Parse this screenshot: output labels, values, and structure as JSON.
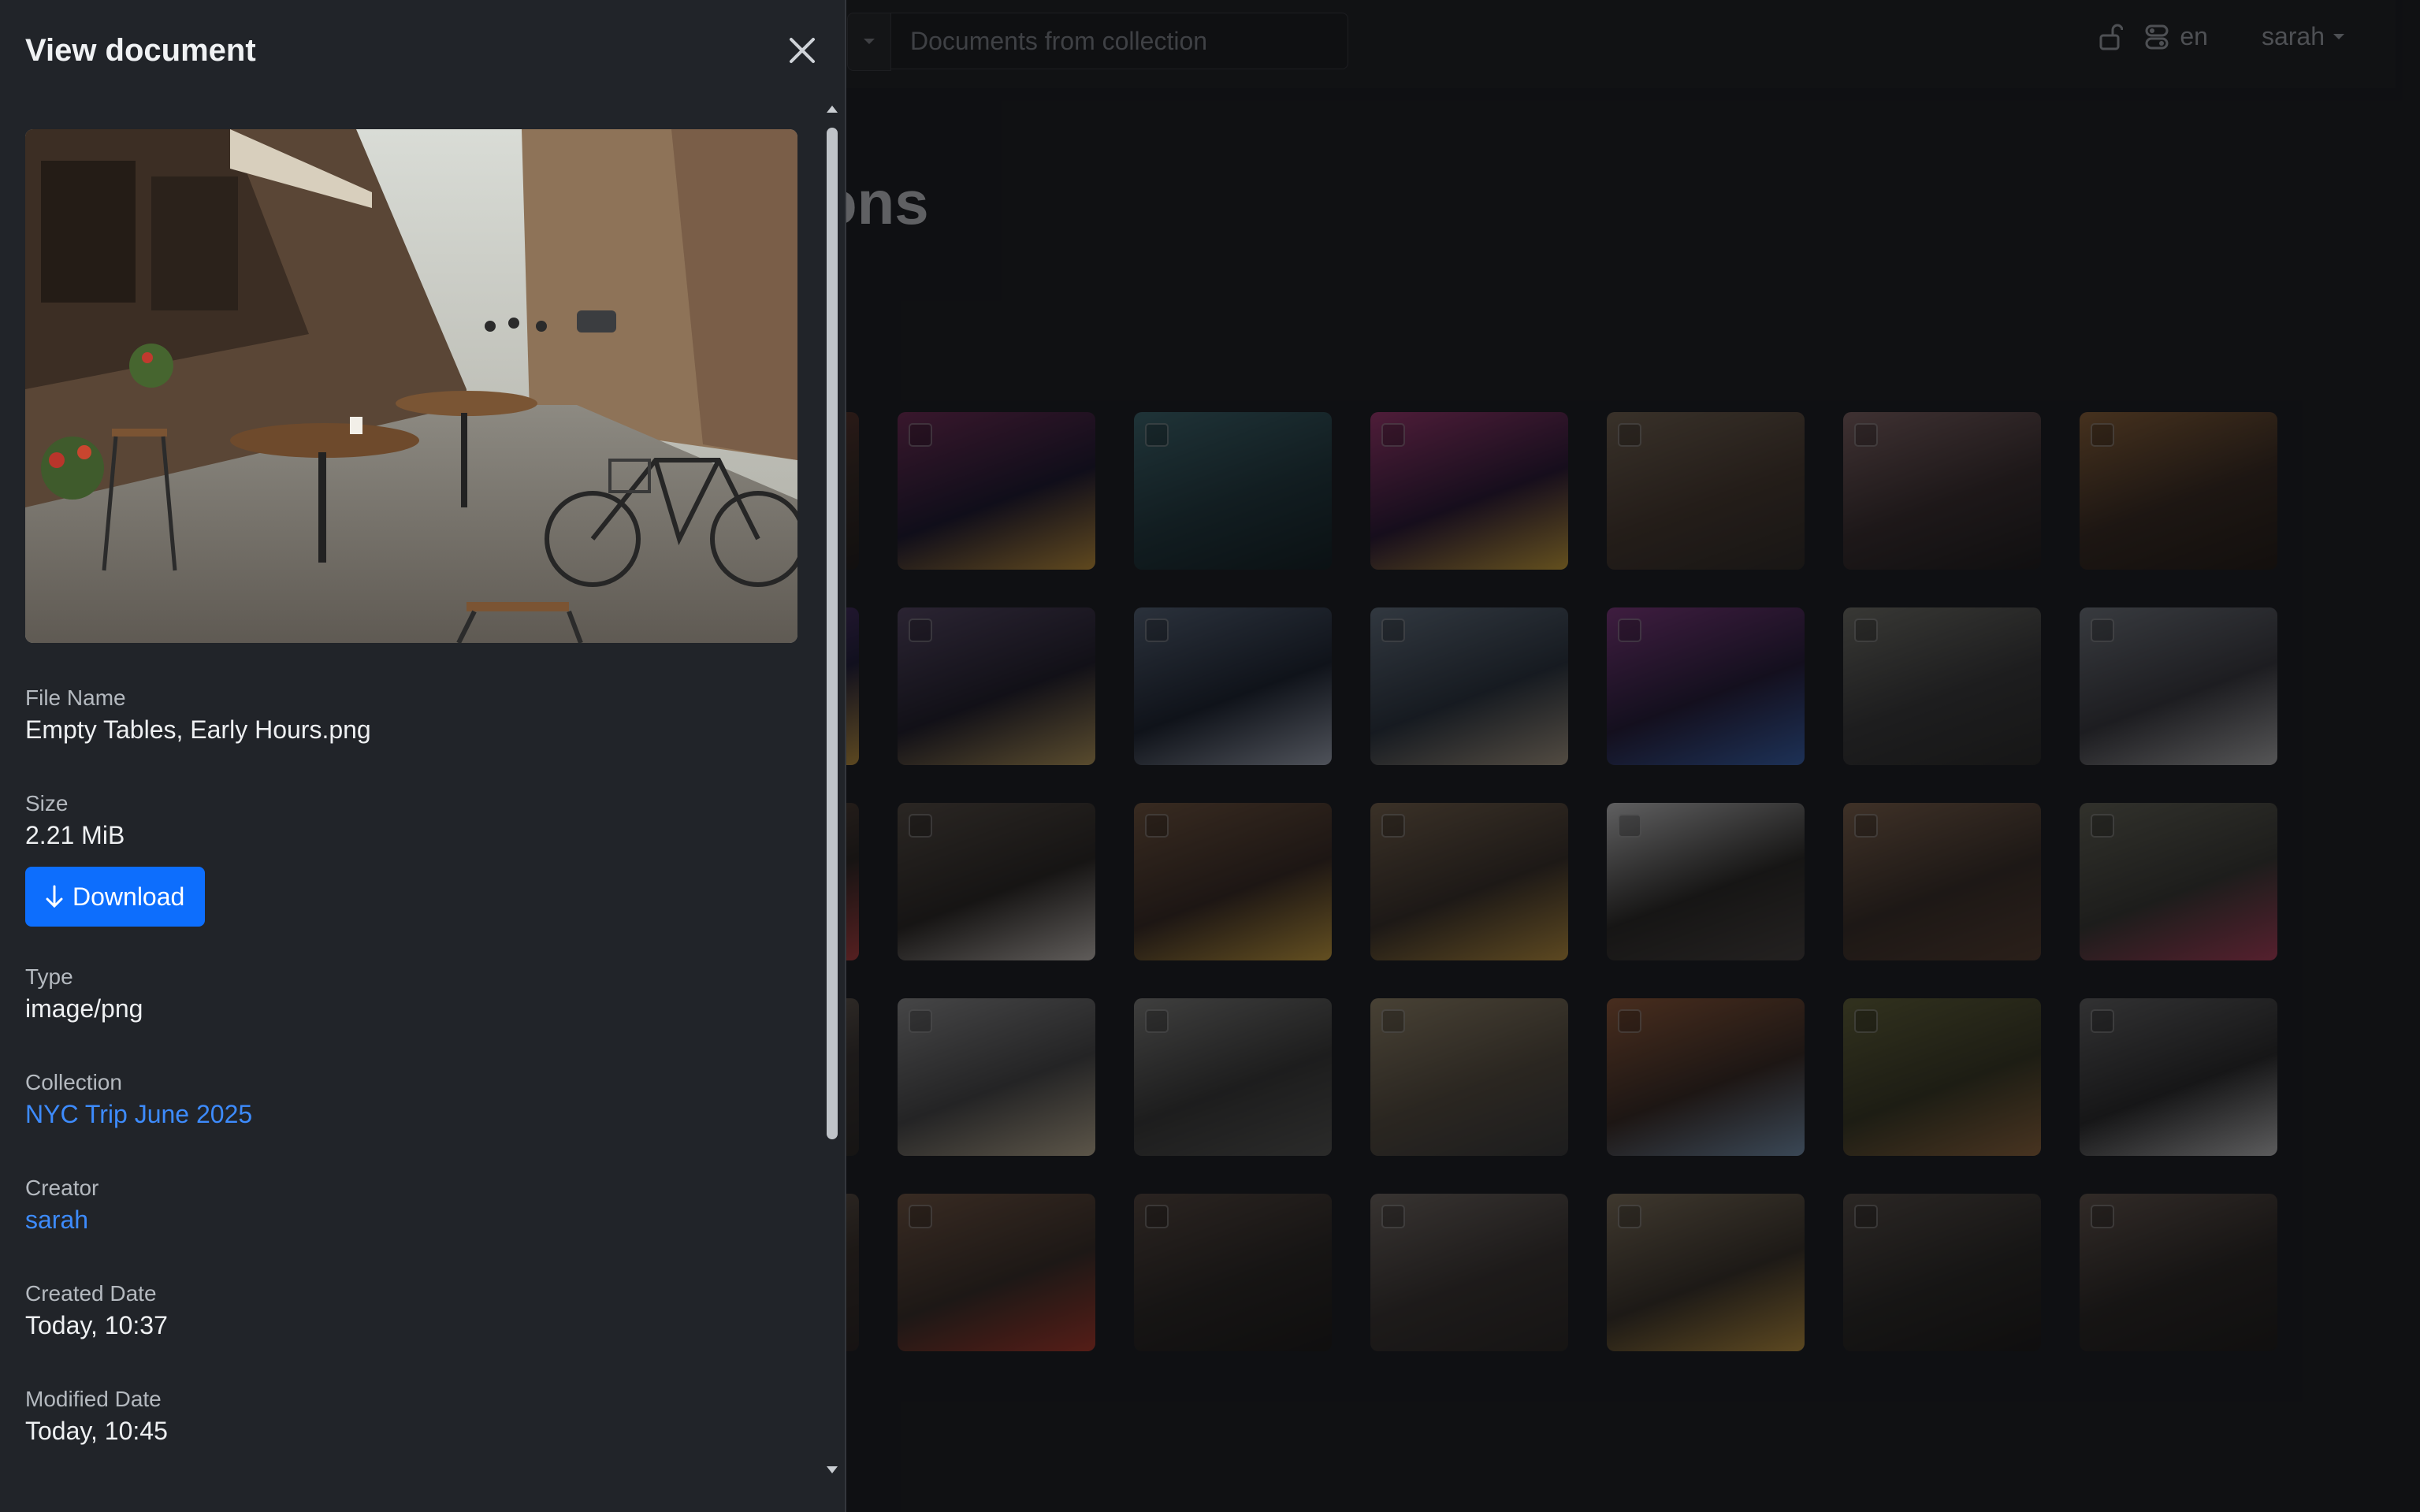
{
  "header": {
    "search_placeholder": "Documents from collection",
    "lang": "en",
    "user": "sarah"
  },
  "main": {
    "title_fragment": "ons"
  },
  "panel": {
    "title": "View document",
    "file_name_label": "File Name",
    "file_name": "Empty Tables, Early Hours.png",
    "size_label": "Size",
    "size": "2.21 MiB",
    "download_label": "Download",
    "type_label": "Type",
    "type": "image/png",
    "collection_label": "Collection",
    "collection": "NYC Trip June 2025",
    "creator_label": "Creator",
    "creator": "sarah",
    "created_label": "Created Date",
    "created": "Today, 10:37",
    "modified_label": "Modified Date",
    "modified": "Today, 10:45"
  },
  "colors": {
    "accent": "#0d6efd",
    "link": "#3d8bfd",
    "panel_bg": "#212429"
  },
  "tile_count": 35
}
